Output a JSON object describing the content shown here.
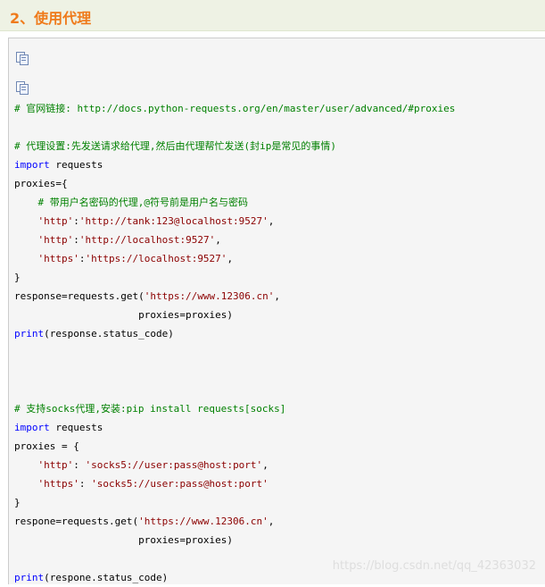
{
  "section": {
    "heading": "2、使用代理"
  },
  "toolbar": {
    "icons": [
      "copy-icon",
      "copy-icon"
    ]
  },
  "code": {
    "lines": [
      [
        {
          "t": "# 官网链接: http://docs.python-requests.org/en/master/user/advanced/#proxies",
          "k": "comment"
        }
      ],
      [],
      [
        {
          "t": "# 代理设置:先发送请求给代理,然后由代理帮忙发送(封ip是常见的事情)",
          "k": "comment"
        }
      ],
      [
        {
          "t": "import",
          "k": "keyword"
        },
        {
          "t": " requests",
          "k": "plain"
        }
      ],
      [
        {
          "t": "proxies={",
          "k": "plain"
        }
      ],
      [
        {
          "t": "    ",
          "k": "plain"
        },
        {
          "t": "# 带用户名密码的代理,@符号前是用户名与密码",
          "k": "comment"
        }
      ],
      [
        {
          "t": "    ",
          "k": "plain"
        },
        {
          "t": "'http'",
          "k": "string"
        },
        {
          "t": ":",
          "k": "plain"
        },
        {
          "t": "'http://tank:123@localhost:9527'",
          "k": "string"
        },
        {
          "t": ",",
          "k": "plain"
        }
      ],
      [
        {
          "t": "    ",
          "k": "plain"
        },
        {
          "t": "'http'",
          "k": "string"
        },
        {
          "t": ":",
          "k": "plain"
        },
        {
          "t": "'http://localhost:9527'",
          "k": "string"
        },
        {
          "t": ",",
          "k": "plain"
        }
      ],
      [
        {
          "t": "    ",
          "k": "plain"
        },
        {
          "t": "'https'",
          "k": "string"
        },
        {
          "t": ":",
          "k": "plain"
        },
        {
          "t": "'https://localhost:9527'",
          "k": "string"
        },
        {
          "t": ",",
          "k": "plain"
        }
      ],
      [
        {
          "t": "}",
          "k": "plain"
        }
      ],
      [
        {
          "t": "response=requests.get(",
          "k": "plain"
        },
        {
          "t": "'https://www.12306.cn'",
          "k": "string"
        },
        {
          "t": ",",
          "k": "plain"
        }
      ],
      [
        {
          "t": "                     proxies=proxies)",
          "k": "plain"
        }
      ],
      [
        {
          "t": "print",
          "k": "keyword"
        },
        {
          "t": "(response.status_code)",
          "k": "plain"
        }
      ],
      [],
      [],
      [],
      [
        {
          "t": "# 支持socks代理,安装:pip install requests[socks]",
          "k": "comment"
        }
      ],
      [
        {
          "t": "import",
          "k": "keyword"
        },
        {
          "t": " requests",
          "k": "plain"
        }
      ],
      [
        {
          "t": "proxies = {",
          "k": "plain"
        }
      ],
      [
        {
          "t": "    ",
          "k": "plain"
        },
        {
          "t": "'http'",
          "k": "string"
        },
        {
          "t": ": ",
          "k": "plain"
        },
        {
          "t": "'socks5://user:pass@host:port'",
          "k": "string"
        },
        {
          "t": ",",
          "k": "plain"
        }
      ],
      [
        {
          "t": "    ",
          "k": "plain"
        },
        {
          "t": "'https'",
          "k": "string"
        },
        {
          "t": ": ",
          "k": "plain"
        },
        {
          "t": "'socks5://user:pass@host:port'",
          "k": "string"
        }
      ],
      [
        {
          "t": "}",
          "k": "plain"
        }
      ],
      [
        {
          "t": "respone=requests.get(",
          "k": "plain"
        },
        {
          "t": "'https://www.12306.cn'",
          "k": "string"
        },
        {
          "t": ",",
          "k": "plain"
        }
      ],
      [
        {
          "t": "                     proxies=proxies)",
          "k": "plain"
        }
      ],
      [],
      [
        {
          "t": "print",
          "k": "keyword"
        },
        {
          "t": "(respone.status_code)",
          "k": "plain"
        }
      ]
    ]
  },
  "watermark": "https://blog.csdn.net/qq_42363032",
  "colors": {
    "heading": "#ef7a1a",
    "comment": "#008000",
    "keyword": "#0000ff",
    "string": "#8b0000",
    "panel_background": "#f5f5f5"
  }
}
